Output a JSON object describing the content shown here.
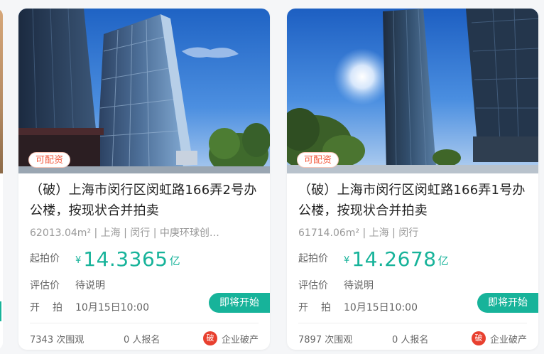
{
  "cards": [
    {
      "badge": "可配资",
      "title": "（破）上海市闵行区闵虹路166弄2号办公楼，按现状合并拍卖",
      "meta": "62013.04m² | 上海 | 闵行 | 中庚环球创…",
      "price_label": "起拍价",
      "price_symbol": "¥",
      "price_value": "14.3365",
      "price_unit": "亿",
      "eval_label": "评估价",
      "eval_value": "待说明",
      "start_label": "开拍",
      "start_value": "10月15日10:00",
      "status": "即将开始",
      "views": "7343 次围观",
      "signups": "0 人报名",
      "type_icon": "破",
      "type_label": "企业破产"
    },
    {
      "badge": "可配资",
      "title": "（破）上海市闵行区闵虹路166弄1号办公楼，按现状合并拍卖",
      "meta": "61714.06m² | 上海 | 闵行",
      "price_label": "起拍价",
      "price_symbol": "¥",
      "price_value": "14.2678",
      "price_unit": "亿",
      "eval_label": "评估价",
      "eval_value": "待说明",
      "start_label": "开拍",
      "start_value": "10月15日10:00",
      "status": "即将开始",
      "views": "7897 次围观",
      "signups": "0 人报名",
      "type_icon": "破",
      "type_label": "企业破产"
    }
  ],
  "colors": {
    "accent": "#17b39a",
    "badge_text": "#f2573b",
    "bankrupt_icon": "#e8402f"
  }
}
